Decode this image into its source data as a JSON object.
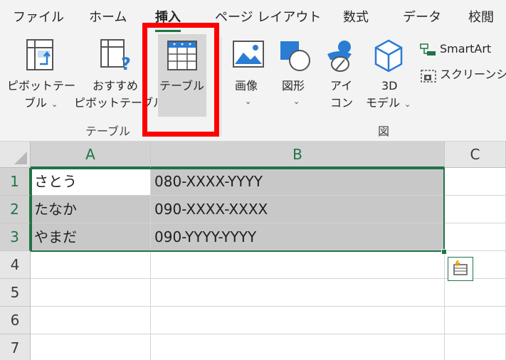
{
  "ribbon": {
    "tabs": [
      {
        "label": "ファイル"
      },
      {
        "label": "ホーム"
      },
      {
        "label": "挿入",
        "active": true
      },
      {
        "label": "ページ レイアウト"
      },
      {
        "label": "数式"
      },
      {
        "label": "データ"
      },
      {
        "label": "校閲"
      }
    ],
    "buttons": {
      "pivot_line1": "ピボットテー",
      "pivot_line2": "ブル",
      "recommended_line1": "おすすめ",
      "recommended_line2": "ピボットテーブル",
      "table": "テーブル",
      "image": "画像",
      "shapes": "図形",
      "icons_line1": "アイ",
      "icons_line2": "コン",
      "model3d_line1": "3D",
      "model3d_line2": "モデル",
      "smartart": "SmartArt",
      "screenshot": "スクリーンショ"
    },
    "groups": {
      "tables": "テーブル",
      "illustrations": "図"
    }
  },
  "sheet": {
    "columns": [
      "A",
      "B",
      "C"
    ],
    "rows": [
      "1",
      "2",
      "3",
      "4",
      "5",
      "6",
      "7"
    ],
    "cells": [
      [
        "さとう",
        "080-XXXX-YYYY"
      ],
      [
        "たなか",
        "090-XXXX-XXXX"
      ],
      [
        "やまだ",
        "090-YYYY-YYYY"
      ]
    ]
  },
  "colors": {
    "excel_green": "#217346",
    "highlight_red": "#ff0000",
    "selection_fill": "#c8c8c8"
  }
}
